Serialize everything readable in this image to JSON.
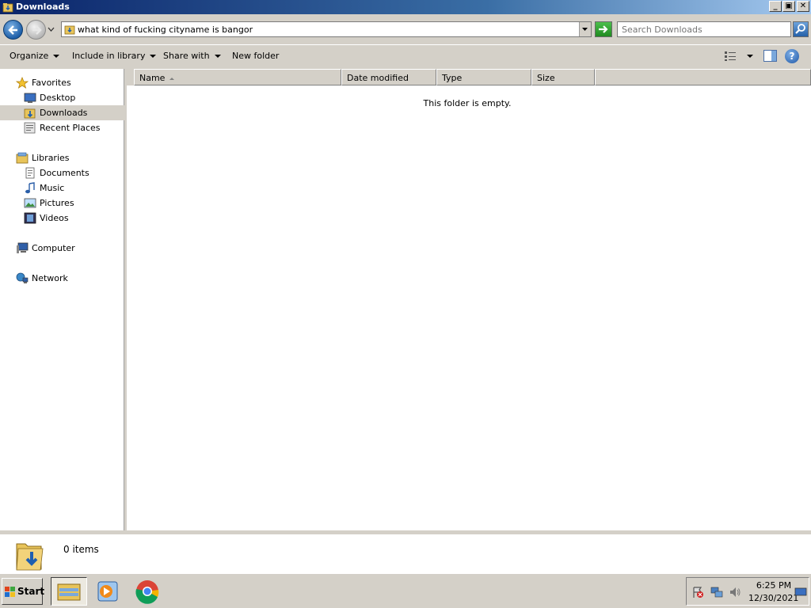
{
  "window": {
    "title": "Downloads"
  },
  "nav_buttons": {
    "back": "Back",
    "forward": "Forward"
  },
  "address": {
    "value": "what kind of fucking cityname is bangor"
  },
  "search": {
    "placeholder": "Search Downloads"
  },
  "commands": {
    "organize": "Organize",
    "include_in_library": "Include in library",
    "share_with": "Share with",
    "new_folder": "New folder"
  },
  "nav_pane": {
    "favorites": {
      "label": "Favorites",
      "items": [
        {
          "label": "Desktop",
          "icon": "desktop-icon"
        },
        {
          "label": "Downloads",
          "icon": "downloads-folder-icon",
          "selected": true
        },
        {
          "label": "Recent Places",
          "icon": "recent-places-icon"
        }
      ]
    },
    "libraries": {
      "label": "Libraries",
      "items": [
        {
          "label": "Documents",
          "icon": "documents-icon"
        },
        {
          "label": "Music",
          "icon": "music-icon"
        },
        {
          "label": "Pictures",
          "icon": "pictures-icon"
        },
        {
          "label": "Videos",
          "icon": "videos-icon"
        }
      ]
    },
    "computer": {
      "label": "Computer"
    },
    "network": {
      "label": "Network"
    }
  },
  "columns": [
    "Name",
    "Date modified",
    "Type",
    "Size"
  ],
  "content": {
    "empty_message": "This folder is empty."
  },
  "details": {
    "item_count": "0 items"
  },
  "taskbar": {
    "start_label": "Start",
    "clock_time": "6:25 PM",
    "clock_date": "12/30/2021"
  },
  "colors": {
    "chrome": "#d4d0c8",
    "title_start": "#0a246a",
    "title_end": "#a6caf0",
    "selection": "#d4d0c8"
  }
}
